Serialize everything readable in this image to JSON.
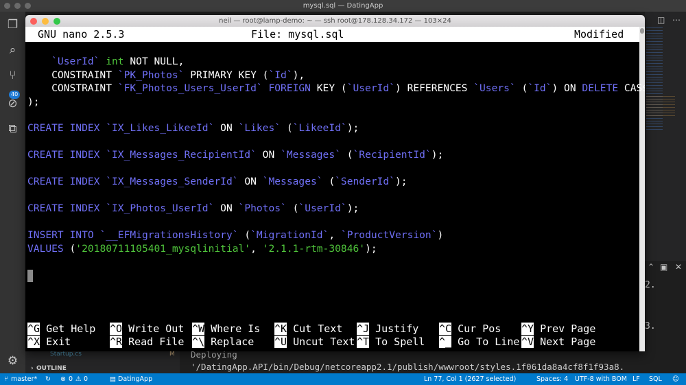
{
  "vscode": {
    "title": "mysql.sql — DatingApp",
    "scm_badge": "40",
    "explorer_file": "Startup.cs",
    "explorer_file_status": "M",
    "outline_label": "OUTLINE",
    "terminal_line1": "Deploying",
    "terminal_line2": "'/DatingApp.API/bin/Debug/netcoreapp2.1/publish/wwwroot/styles.1f061da8a4cf8f1f93a8.",
    "right_panel_text1": "2.",
    "right_panel_text2": "3.",
    "status": {
      "branch": "master*",
      "errors": "0",
      "warnings": "0",
      "project": "DatingApp",
      "position": "Ln 77, Col 1 (2627 selected)",
      "spaces": "Spaces: 4",
      "encoding": "UTF-8 with BOM",
      "eol": "LF",
      "language": "SQL"
    }
  },
  "terminal": {
    "title": "neil — root@lamp-demo: ~ — ssh root@178.128.34.172 — 103×24",
    "nano": {
      "version": "GNU nano 2.5.3",
      "file": "File: mysql.sql",
      "state": "Modified"
    },
    "code": {
      "l1": {
        "a": "    `UserId` ",
        "b": "int",
        "c": " NOT NULL,"
      },
      "l2": {
        "a": "    CONSTRAINT ",
        "b": "`PK_Photos`",
        "c": " PRIMARY KEY (",
        "d": "`Id`",
        "e": "),"
      },
      "l3": {
        "a": "    CONSTRAINT ",
        "b": "`FK_Photos_Users_UserId`",
        "c": " ",
        "d": "FOREIGN",
        "e": " KEY (",
        "f": "`UserId`",
        "g": ") REFERENCES ",
        "h": "`Users`",
        "i": " (",
        "j": "`Id`",
        "k": ") ON ",
        "l": "DELETE",
        "m": " CAS$"
      },
      "l4": ");",
      "l5": {
        "a": "CREATE INDEX",
        "b": " `IX_Likes_LikeeId`",
        "c": " ON ",
        "d": "`Likes`",
        "e": " (",
        "f": "`LikeeId`",
        "g": ");"
      },
      "l6": {
        "a": "CREATE INDEX",
        "b": " `IX_Messages_RecipientId`",
        "c": " ON ",
        "d": "`Messages`",
        "e": " (",
        "f": "`RecipientId`",
        "g": ");"
      },
      "l7": {
        "a": "CREATE INDEX",
        "b": " `IX_Messages_SenderId`",
        "c": " ON ",
        "d": "`Messages`",
        "e": " (",
        "f": "`SenderId`",
        "g": ");"
      },
      "l8": {
        "a": "CREATE INDEX",
        "b": " `IX_Photos_UserId`",
        "c": " ON ",
        "d": "`Photos`",
        "e": " (",
        "f": "`UserId`",
        "g": ");"
      },
      "l9": {
        "a": "INSERT INTO",
        "b": " `__EFMigrationsHistory`",
        "c": " (",
        "d": "`MigrationId`",
        "e": ", ",
        "f": "`ProductVersion`",
        "g": ")"
      },
      "l10": {
        "a": "VALUES",
        "b": " (",
        "c": "'20180711105401_mysqlinitial'",
        "d": ", ",
        "e": "'2.1.1-rtm-30846'",
        "f": ");"
      }
    },
    "shortcuts": [
      {
        "key": "^G",
        "label": "Get Help"
      },
      {
        "key": "^O",
        "label": "Write Out"
      },
      {
        "key": "^W",
        "label": "Where Is"
      },
      {
        "key": "^K",
        "label": "Cut Text"
      },
      {
        "key": "^J",
        "label": "Justify"
      },
      {
        "key": "^C",
        "label": "Cur Pos"
      },
      {
        "key": "^Y",
        "label": "Prev Page"
      },
      {
        "key": "^X",
        "label": "Exit"
      },
      {
        "key": "^R",
        "label": "Read File"
      },
      {
        "key": "^\\",
        "label": "Replace"
      },
      {
        "key": "^U",
        "label": "Uncut Text"
      },
      {
        "key": "^T",
        "label": "To Spell"
      },
      {
        "key": "^_",
        "label": "Go To Line"
      },
      {
        "key": "^V",
        "label": "Next Page"
      }
    ]
  }
}
